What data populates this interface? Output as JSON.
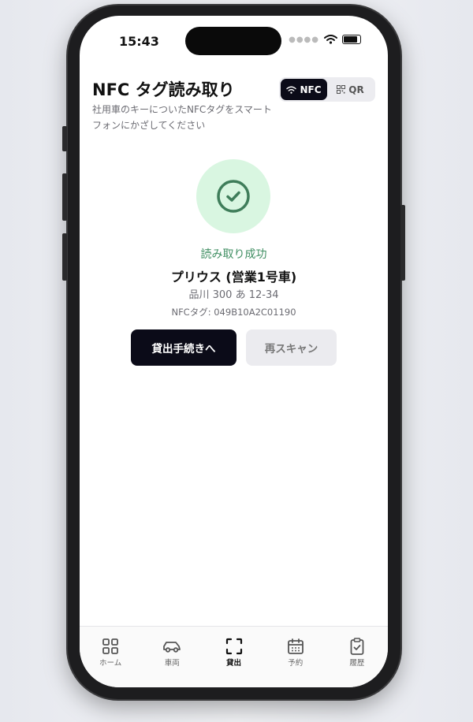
{
  "status_bar": {
    "time": "15:43"
  },
  "header": {
    "title": "NFC タグ読み取り",
    "subtitle": "社用車のキーについたNFCタグをスマートフォンにかざしてください"
  },
  "mode_toggle": {
    "options": [
      {
        "label": "NFC",
        "icon": "nfc-signal-icon",
        "active": true
      },
      {
        "label": "QR",
        "icon": "qr-code-icon",
        "active": false
      }
    ]
  },
  "result": {
    "status": "読み取り成功",
    "car_name": "プリウス (営業1号車)",
    "plate": "品川 300 あ 12-34",
    "nfc_tag": "NFCタグ: 049B10A2C01190",
    "accent_color": "#3f8e62"
  },
  "actions": {
    "primary_label": "貸出手続きへ",
    "secondary_label": "再スキャン"
  },
  "tabbar": {
    "items": [
      {
        "label": "ホーム",
        "icon": "grid-icon"
      },
      {
        "label": "車両",
        "icon": "car-icon"
      },
      {
        "label": "貸出",
        "icon": "scan-icon",
        "active": true
      },
      {
        "label": "予約",
        "icon": "calendar-icon"
      },
      {
        "label": "履歴",
        "icon": "clipboard-check-icon"
      }
    ]
  }
}
